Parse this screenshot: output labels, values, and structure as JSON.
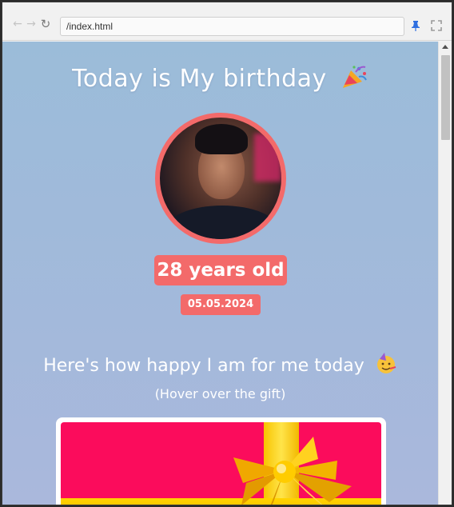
{
  "browser": {
    "address": "/index.html",
    "icons": [
      "back-arrow-icon",
      "forward-arrow-icon",
      "reload-icon",
      "pin-icon",
      "fullscreen-icon"
    ]
  },
  "page": {
    "title": "Today is My birthday",
    "title_emoji": "party-popper",
    "age": "28 years old",
    "date": "05.05.2024",
    "happy_heading": "Here's how happy I am for me today",
    "happy_emoji": "partying-face",
    "hover_hint": "(Hover over the gift)"
  },
  "colors": {
    "accent": "#f36a6a",
    "background_top": "#9bbcd9",
    "background_bottom": "#aab8dc",
    "gift_box": "#fb0c5c",
    "ribbon": "#ffd400"
  }
}
